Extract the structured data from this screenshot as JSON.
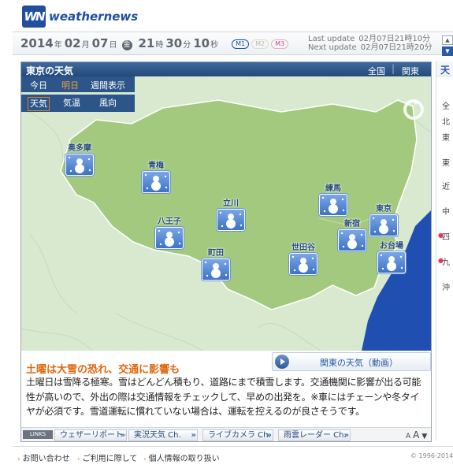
{
  "header": {
    "logo_mark": "WN",
    "logo_text": "weathernews"
  },
  "clock": {
    "year": "2014",
    "year_unit": "年",
    "month": "02",
    "month_unit": "月",
    "day": "07",
    "day_unit": "日",
    "weekday": "金",
    "hour": "21",
    "hour_unit": "時",
    "minute": "30",
    "minute_unit": "分",
    "second": "10",
    "second_unit": "秒",
    "mode_buttons": [
      "M1",
      "M2",
      "M3"
    ]
  },
  "update": {
    "last_label": "Last update",
    "last_value": "02月07日21時10分",
    "next_label": "Next update",
    "next_value": "02月07日21時20分"
  },
  "panel": {
    "title": "東京の天気",
    "scope_all": "全国",
    "scope_sep": "|",
    "scope_kanto": "関東"
  },
  "tabs": {
    "days": [
      "今日",
      "明日",
      "週間表示"
    ],
    "active_day": "明日",
    "types": [
      "天気",
      "気温",
      "風向"
    ],
    "active_type": "天気"
  },
  "cities": [
    {
      "name": "奥多摩",
      "weather_icon": "snow-icon"
    },
    {
      "name": "青梅",
      "weather_icon": "snow-icon"
    },
    {
      "name": "八王子",
      "weather_icon": "snow-icon"
    },
    {
      "name": "立川",
      "weather_icon": "snow-icon"
    },
    {
      "name": "町田",
      "weather_icon": "snow-icon"
    },
    {
      "name": "練馬",
      "weather_icon": "snow-icon"
    },
    {
      "name": "世田谷",
      "weather_icon": "snow-icon"
    },
    {
      "name": "新宿",
      "weather_icon": "snow-icon"
    },
    {
      "name": "東京",
      "weather_icon": "snow-icon"
    },
    {
      "name": "お台場",
      "weather_icon": "snow-icon"
    }
  ],
  "info": {
    "headline": "土曜は大雪の恐れ、交通に影響も",
    "video_label": "関東の天気（動画）",
    "body": "土曜日は雪降る極寒。雪はどんどん積もり、道路にまで積雪します。交通機関に影響が出る可能性が高いので、外出の際は交通情報をチェックして、早めの出発を。※車にはチェーンや冬タイヤが必須です。雪道運転に慣れていない場合は、運転を控えるのが良さそうです。"
  },
  "links": {
    "tag": "LINKS",
    "items": [
      "ウェザーリポート Ch.",
      "実況天気 Ch.",
      "ライブカメラ Ch.",
      "雨雲レーダー Ch."
    ],
    "nav": [
      "A",
      "A",
      "▼"
    ]
  },
  "right_panel": {
    "title": "天",
    "lines": [
      "全",
      "北",
      "東",
      "東",
      "近",
      "中",
      "四",
      "九",
      "沖"
    ]
  },
  "footer": {
    "links": [
      "お問い合わせ",
      "ご利用に際して",
      "個人情報の取り扱い"
    ],
    "copyright": "© 1996-2014"
  },
  "colors": {
    "brand_blue": "#1f4f9e",
    "header_navy": "#22497a",
    "land_green": "#a3c97e",
    "sea_blue": "#1f4fb0",
    "headline_orange": "#e0670f",
    "active_tab_orange": "#e67e1e"
  }
}
